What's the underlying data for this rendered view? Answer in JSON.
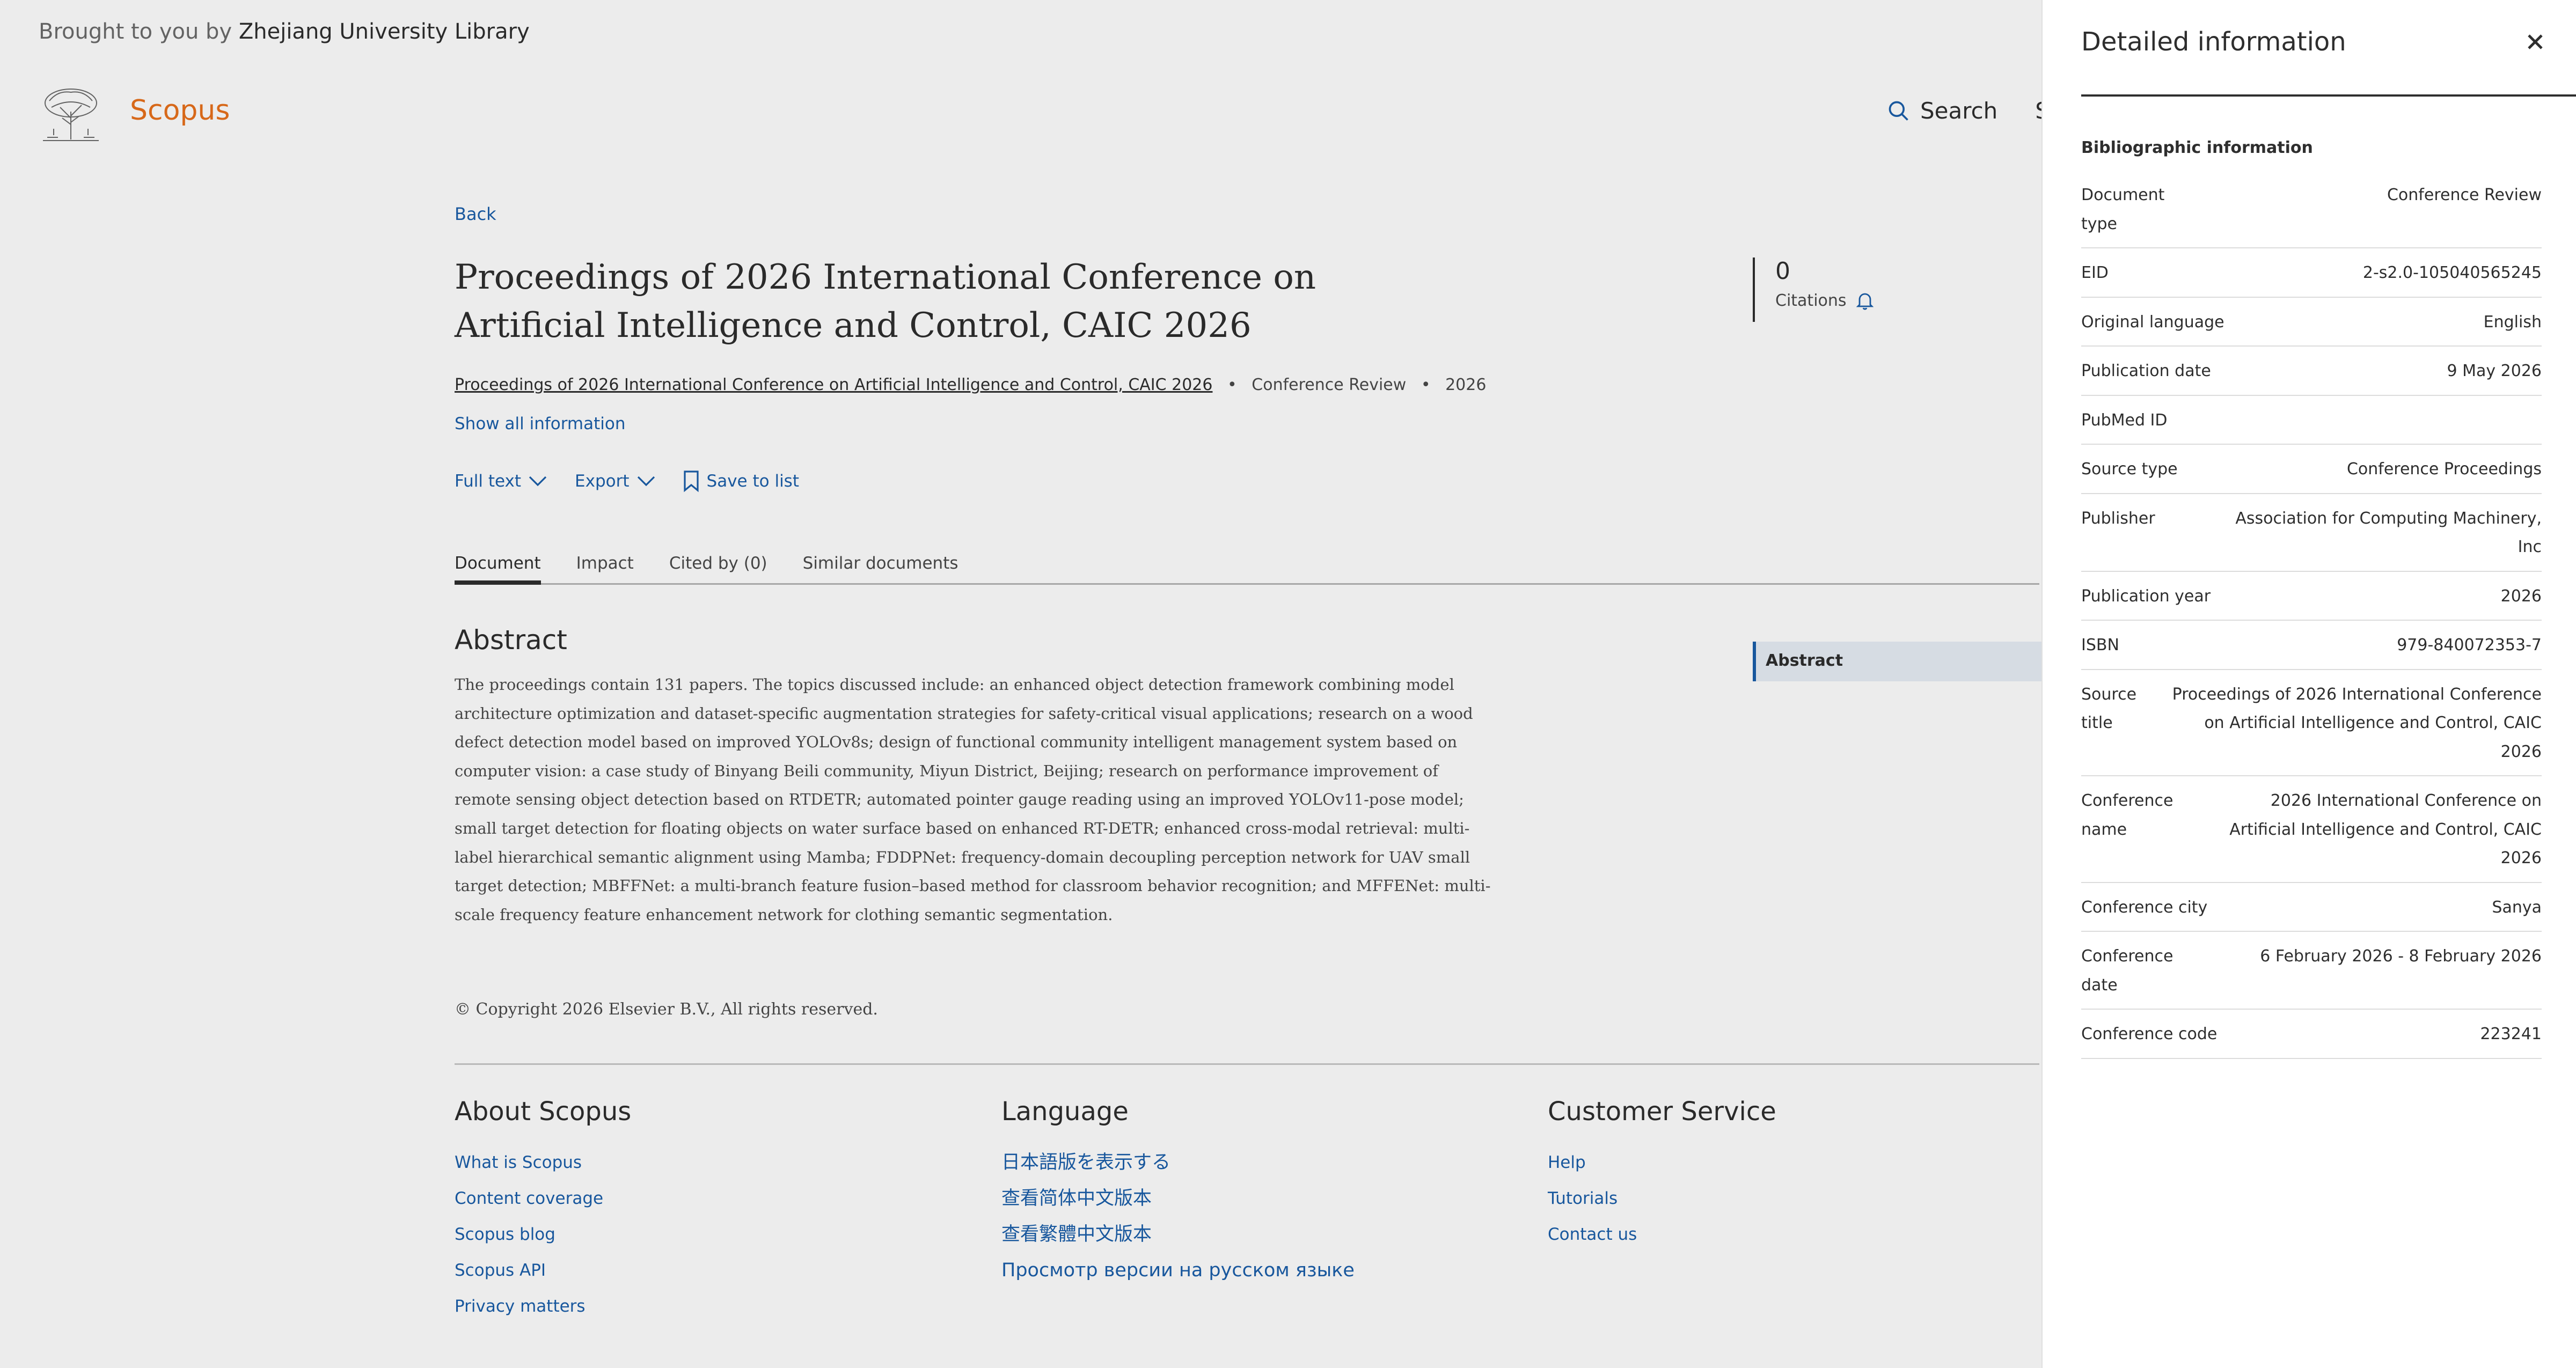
{
  "header": {
    "brought_prefix": "Brought to you by",
    "library": "Zhejiang University Library",
    "brand": "Scopus",
    "search_label": "Search",
    "search_cut": "S"
  },
  "document": {
    "back": "Back",
    "title": "Proceedings of 2026 International Conference on Artificial Intelligence and Control, CAIC 2026",
    "source_link": "Proceedings of 2026 International Conference on Artificial Intelligence and Control, CAIC 2026",
    "doc_type": "Conference Review",
    "year": "2026",
    "show_all": "Show all information",
    "actions": {
      "full_text": "Full text",
      "export": "Export",
      "save": "Save to list"
    },
    "citations": {
      "count": "0",
      "label": "Citations"
    },
    "tabs": [
      "Document",
      "Impact",
      "Cited by (0)",
      "Similar documents"
    ],
    "abstract_heading": "Abstract",
    "abstract": "The proceedings contain 131 papers. The topics discussed include: an enhanced object detection framework combining model architecture optimization and dataset-specific augmentation strategies for safety-critical visual applications; research on a wood defect detection model based on improved YOLOv8s; design of functional community intelligent management system based on computer vision: a case study of Binyang Beili community, Miyun District, Beijing; research on performance improvement of remote sensing object detection based on RTDETR; automated pointer gauge reading using an improved YOLOv11-pose model; small target detection for floating objects on water surface based on enhanced RT-DETR; enhanced cross-modal retrieval: multi-label hierarchical semantic alignment using Mamba; FDDPNet: frequency-domain decoupling perception network for UAV small target detection; MBFFNet: a multi-branch feature fusion–based method for classroom behavior recognition; and MFFENet: multi-scale frequency feature enhancement network for clothing semantic segmentation.",
    "abstract_nav": "Abstract",
    "copyright": "© Copyright 2026 Elsevier B.V., All rights reserved."
  },
  "footer": {
    "about": {
      "heading": "About Scopus",
      "links": [
        "What is Scopus",
        "Content coverage",
        "Scopus blog",
        "Scopus API",
        "Privacy matters"
      ]
    },
    "language": {
      "heading": "Language",
      "links": [
        "日本語版を表示する",
        "查看简体中文版本",
        "查看繁體中文版本",
        "Просмотр версии на русском языке"
      ]
    },
    "service": {
      "heading": "Customer Service",
      "links": [
        "Help",
        "Tutorials",
        "Contact us"
      ]
    }
  },
  "panel": {
    "title": "Detailed information",
    "section": "Bibliographic information",
    "rows": [
      {
        "k": "Document type",
        "v": "Conference Review"
      },
      {
        "k": "EID",
        "v": "2-s2.0-105040565245"
      },
      {
        "k": "Original language",
        "v": "English"
      },
      {
        "k": "Publication date",
        "v": "9 May 2026"
      },
      {
        "k": "PubMed ID",
        "v": ""
      },
      {
        "k": "Source type",
        "v": "Conference Proceedings"
      },
      {
        "k": "Publisher",
        "v": "Association for Computing Machinery, Inc"
      },
      {
        "k": "Publication year",
        "v": "2026"
      },
      {
        "k": "ISBN",
        "v": "979-840072353-7"
      },
      {
        "k": "Source title",
        "v": "Proceedings of 2026 International Conference on Artificial Intelligence and Control, CAIC 2026"
      },
      {
        "k": "Conference name",
        "v": "2026 International Conference on Artificial Intelligence and Control, CAIC 2026"
      },
      {
        "k": "Conference city",
        "v": "Sanya"
      },
      {
        "k": "Conference date",
        "v": "6 February 2026 - 8 February 2026"
      },
      {
        "k": "Conference code",
        "v": "223241"
      }
    ]
  },
  "colors": {
    "link": "#1b5faa",
    "brand": "#e9711c",
    "text": "#2e2e2e"
  },
  "icons": [
    "logo-tree-icon",
    "search-icon",
    "chevron-down-icon",
    "bookmark-icon",
    "bell-icon",
    "close-icon"
  ]
}
